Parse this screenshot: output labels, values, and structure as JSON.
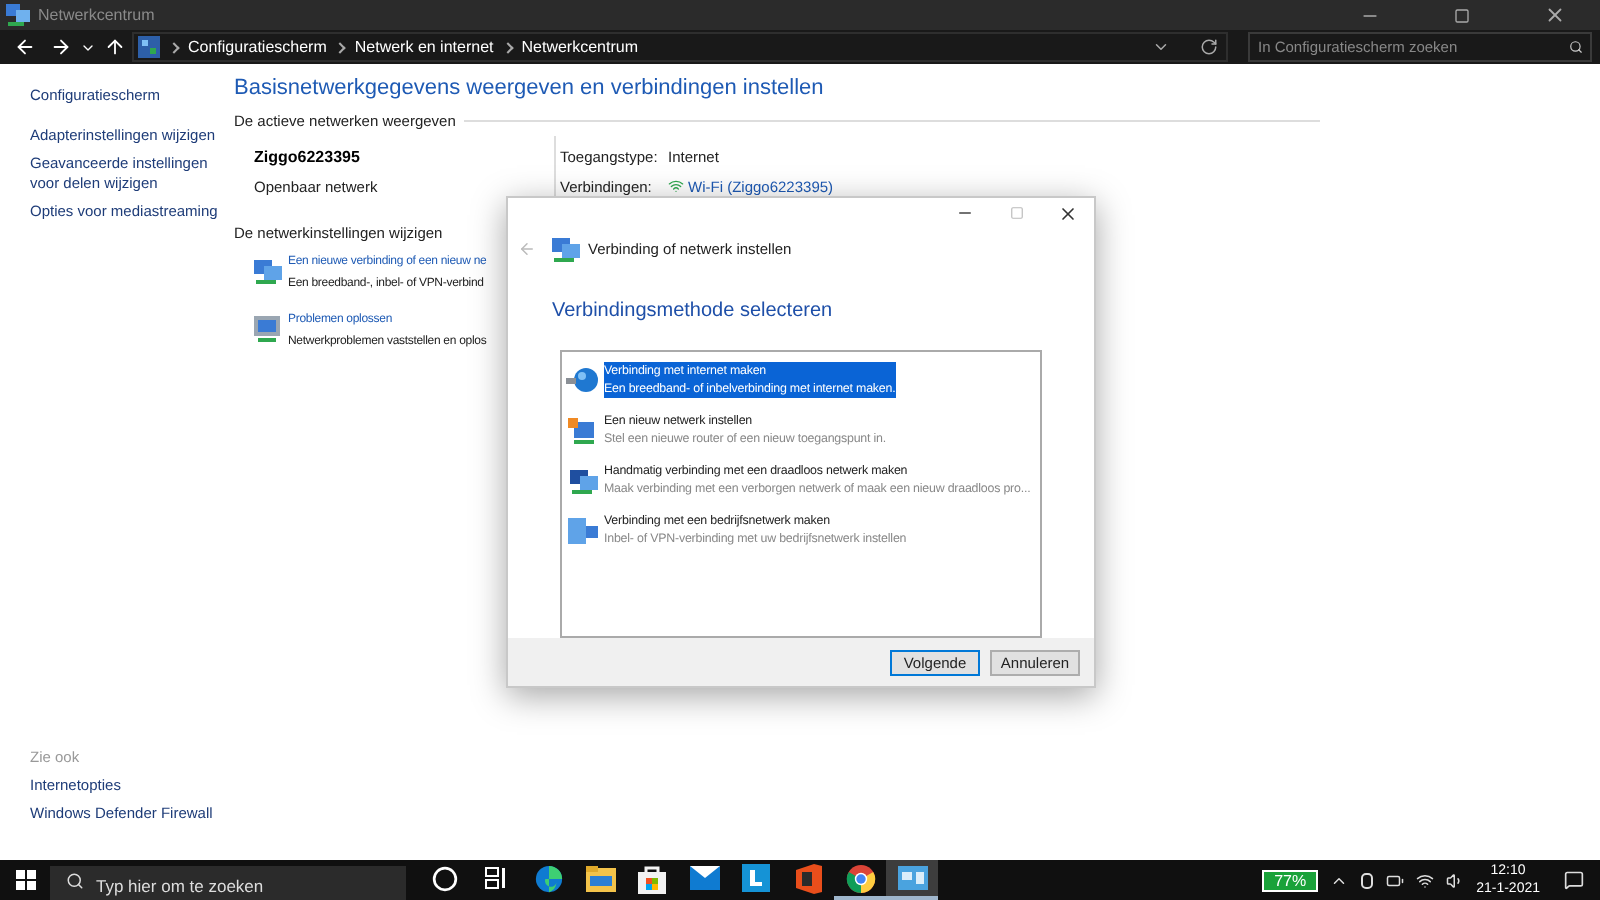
{
  "window": {
    "title": "Netwerkcentrum"
  },
  "address_bar": {
    "breadcrumbs": [
      "Configuratiescherm",
      "Netwerk en internet",
      "Netwerkcentrum"
    ],
    "search": {
      "placeholder": "In Configuratiescherm zoeken"
    }
  },
  "sidebar": {
    "home": "Configuratiescherm",
    "links": [
      "Adapterinstellingen wijzigen",
      "Geavanceerde instellingen voor delen wijzigen",
      "Opties voor mediastreaming"
    ],
    "see_also_title": "Zie ook",
    "see_also": [
      "Internetopties",
      "Windows Defender Firewall"
    ]
  },
  "main": {
    "heading": "Basisnetwerkgegevens weergeven en verbindingen instellen",
    "active_section": "De actieve netwerken weergeven",
    "network": {
      "name": "Ziggo6223395",
      "type": "Openbaar netwerk",
      "access_label": "Toegangstype:",
      "access_value": "Internet",
      "connections_label": "Verbindingen:",
      "connections_value": "Wi-Fi (Ziggo6223395)"
    },
    "change_section": "De netwerkinstellingen wijzigen",
    "tasks": [
      {
        "kind": "new-connection",
        "title": "Een nieuwe verbinding of een nieuw ne",
        "description": "Een breedband-, inbel- of VPN-verbind"
      },
      {
        "kind": "troubleshoot",
        "title": "Problemen oplossen",
        "description": "Netwerkproblemen vaststellen en oplos"
      }
    ]
  },
  "dialog": {
    "title": "Verbinding of netwerk instellen",
    "heading": "Verbindingsmethode selecteren",
    "options": [
      {
        "kind": "internet",
        "title": "Verbinding met internet maken",
        "description": "Een breedband- of inbelverbinding met internet maken.",
        "selected": true
      },
      {
        "kind": "new-network",
        "title": "Een nieuw netwerk instellen",
        "description": "Stel een nieuwe router of een nieuw toegangspunt in.",
        "selected": false
      },
      {
        "kind": "wireless",
        "title": "Handmatig verbinding met een draadloos netwerk maken",
        "description": "Maak verbinding met een verborgen netwerk of maak een nieuw draadloos pro...",
        "selected": false
      },
      {
        "kind": "workplace",
        "title": "Verbinding met een bedrijfsnetwerk maken",
        "description": "Inbel- of VPN-verbinding met uw bedrijfsnetwerk instellen",
        "selected": false
      }
    ],
    "buttons": [
      "Volgende",
      "Annuleren"
    ]
  },
  "taskbar": {
    "search": {
      "placeholder": "Typ hier om te zoeken"
    },
    "apps": [
      {
        "kind": "cortana",
        "running": false,
        "active": false
      },
      {
        "kind": "task-view",
        "running": false,
        "active": false
      },
      {
        "kind": "edge",
        "running": false,
        "active": false
      },
      {
        "kind": "explorer",
        "running": false,
        "active": false
      },
      {
        "kind": "store",
        "running": false,
        "active": false
      },
      {
        "kind": "mail",
        "running": false,
        "active": false
      },
      {
        "kind": "tile",
        "running": false,
        "active": false
      },
      {
        "kind": "office",
        "running": false,
        "active": false
      },
      {
        "kind": "chrome",
        "running": true,
        "active": false
      },
      {
        "kind": "control-panel",
        "running": true,
        "active": true
      }
    ],
    "battery": "77%",
    "time": "12:10",
    "date": "21-1-2021"
  }
}
